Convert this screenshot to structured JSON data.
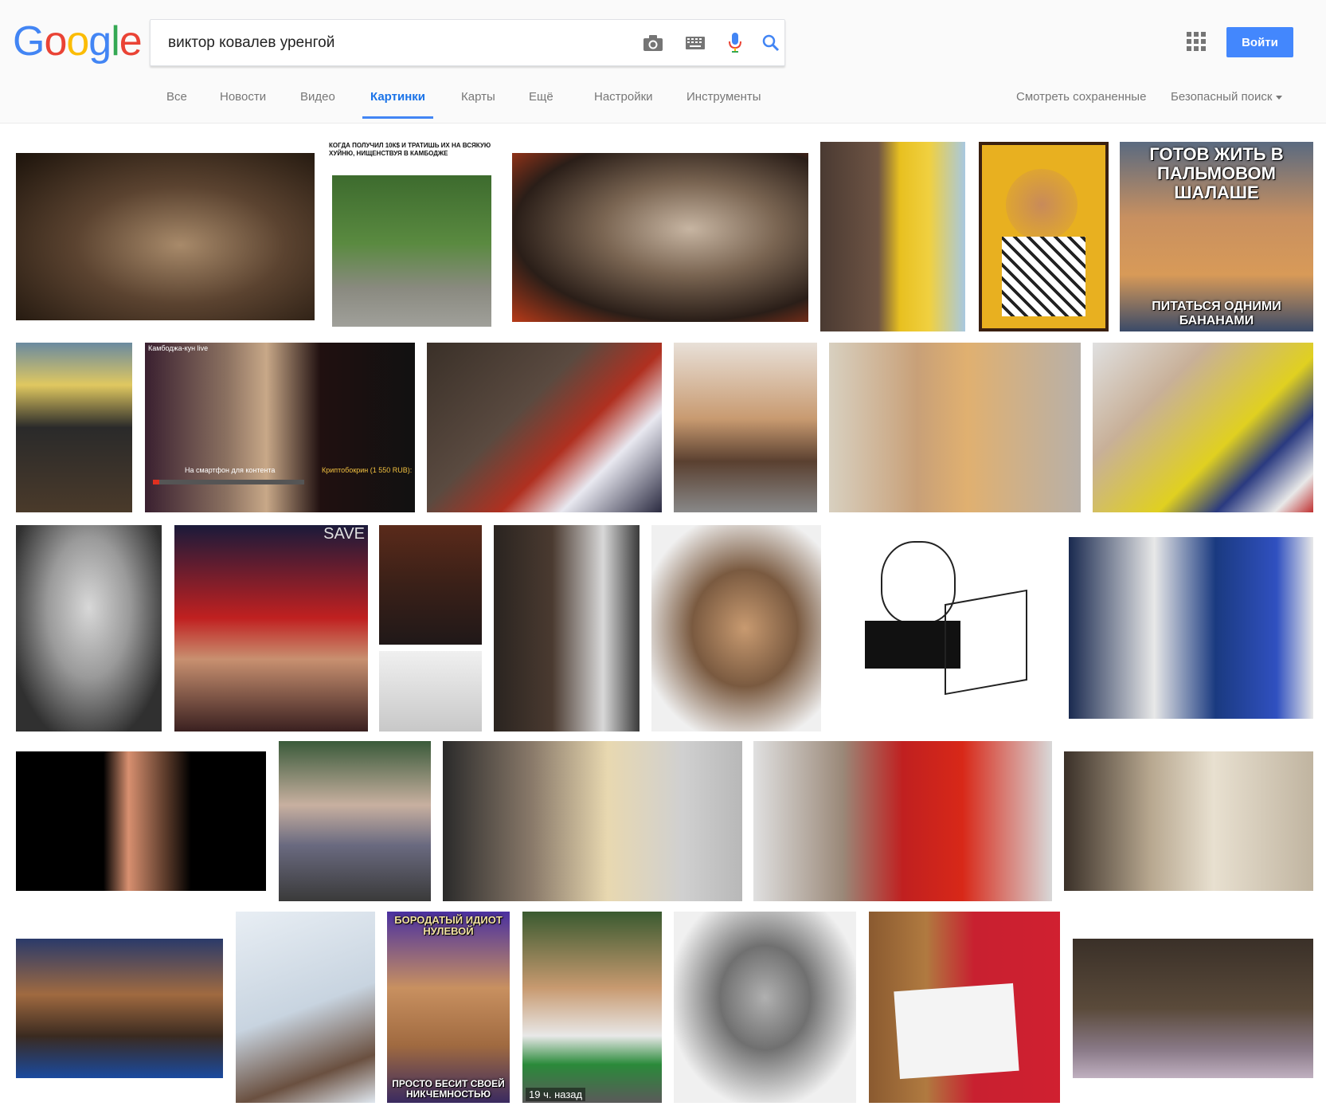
{
  "logo": {
    "text": "Google",
    "letters": [
      "G",
      "o",
      "o",
      "g",
      "l",
      "e"
    ],
    "colors": [
      "#4285f4",
      "#ea4335",
      "#fbbc05",
      "#4285f4",
      "#34a853",
      "#ea4335"
    ]
  },
  "search": {
    "value": "виктор ковалев уренгой",
    "icons": [
      "camera-icon",
      "keyboard-icon",
      "mic-icon",
      "search-icon"
    ]
  },
  "header": {
    "signin_label": "Войти",
    "apps_icon": "apps-grid-icon"
  },
  "tabs": [
    {
      "label": "Все",
      "active": false
    },
    {
      "label": "Новости",
      "active": false
    },
    {
      "label": "Видео",
      "active": false
    },
    {
      "label": "Картинки",
      "active": true
    },
    {
      "label": "Карты",
      "active": false
    },
    {
      "label": "Ещё",
      "active": false
    },
    {
      "label": "Настройки",
      "active": false
    },
    {
      "label": "Инструменты",
      "active": false
    }
  ],
  "right_links": {
    "saved": "Смотреть сохраненные",
    "safe_search": "Безопасный поиск"
  },
  "accent_color": "#4285f4",
  "results": {
    "captions": {
      "r1_2_top": "КОГДА ПОЛУЧИЛ 10К$ И ТРАТИШЬ ИХ НА ВСЯКУЮ ХУЙНЮ, НИЩЕНСТВУЯ В КАМБОДЖЕ",
      "r1_6_top": "ГОТОВ ЖИТЬ В ПАЛЬМОВОМ ШАЛАШЕ",
      "r1_6_bottom": "ПИТАТЬСЯ ОДНИМИ БАНАНАМИ",
      "r2_2_top": "Камбоджа-кун live",
      "r2_2_bottom": "На смартфон для контента",
      "r2_2_side": "Криптобокрин (1 550 RUB):",
      "r3_2_top": "SAVE",
      "r5_3_top": "БОРОДАТЫЙ ИДИОТ НУЛЕВОЙ",
      "r5_3_bottom": "ПРОСТО БЕСИТ СВОЕЙ НИКЧЕМНОСТЬЮ",
      "r5_4_stamp": "19 ч. назад"
    }
  }
}
